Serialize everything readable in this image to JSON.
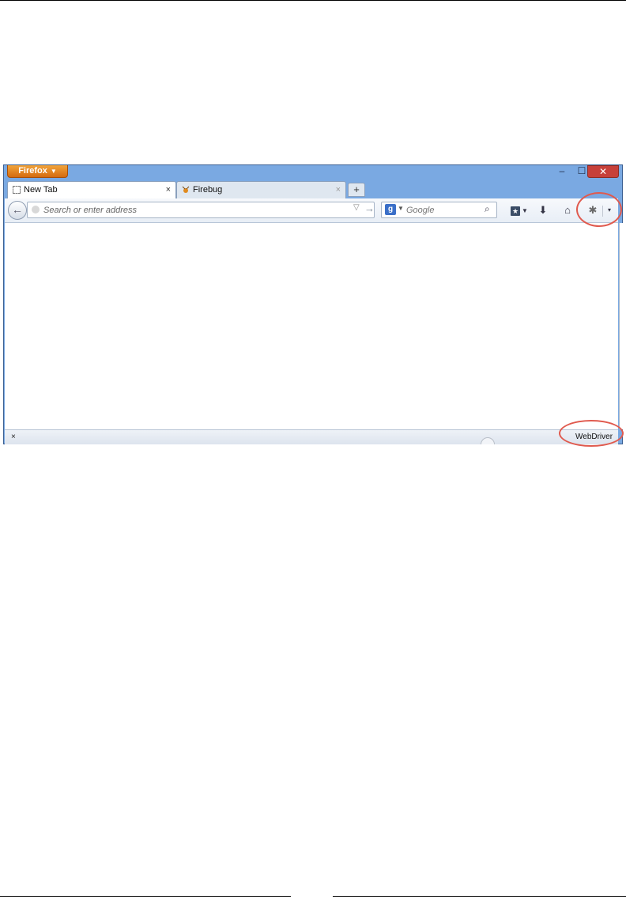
{
  "window": {
    "app_menu_label": "Firefox",
    "controls": {
      "minimize": "–",
      "maximize": "☐",
      "close": "✕"
    }
  },
  "tabs": [
    {
      "label": "New Tab",
      "active": true,
      "close": "×"
    },
    {
      "label": "Firebug",
      "active": false,
      "close": "×"
    }
  ],
  "new_tab_button": "+",
  "navbar": {
    "back_glyph": "←",
    "address_placeholder": "Search or enter address",
    "address_dropmarker": "▽",
    "go_glyph": "→",
    "search_engine_letter": "g",
    "search_placeholder": "Google",
    "search_glyph": "⌕",
    "bookmarks_glyph": "★",
    "downloads_glyph": "⬇",
    "home_glyph": "⌂",
    "firebug_glyph": "✱",
    "menu_caret": "▾"
  },
  "addon_bar": {
    "close_glyph": "×",
    "webdriver_label": "WebDriver"
  },
  "colors": {
    "window_frame": "#7aa9e2",
    "firefox_button": "#e07f1c",
    "close_button": "#c7403a",
    "annotation": "#e05a4e"
  }
}
